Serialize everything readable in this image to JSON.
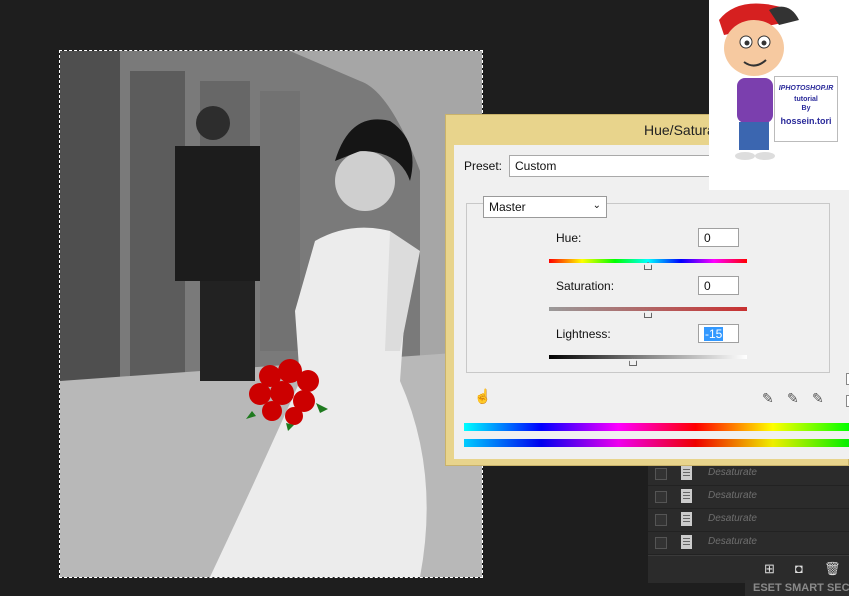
{
  "dialog": {
    "title": "Hue/Saturation",
    "preset_label": "Preset:",
    "preset_value": "Custom",
    "channel_value": "Master",
    "hue": {
      "label": "Hue:",
      "value": "0",
      "level": 0.5
    },
    "saturation": {
      "label": "Saturation:",
      "value": "0",
      "level": 0.5
    },
    "lightness": {
      "label": "Lightness:",
      "value": "-15",
      "level": 0.425
    }
  },
  "history": {
    "items": [
      "Desaturate",
      "Desaturate",
      "Desaturate",
      "Desaturate"
    ]
  },
  "taskbar": {
    "text": "ESET SMART SECURITY"
  },
  "logo": {
    "line1": "IPHOTOSHOP.IR",
    "line2": "tutorial",
    "line3": "By",
    "line4": "hossein.tori"
  },
  "colors": {
    "dialog_frame": "#e8d48c",
    "panel_bg": "#2b2b2b",
    "selection_blue": "#3399ff",
    "rose_red": "#cc0000"
  }
}
